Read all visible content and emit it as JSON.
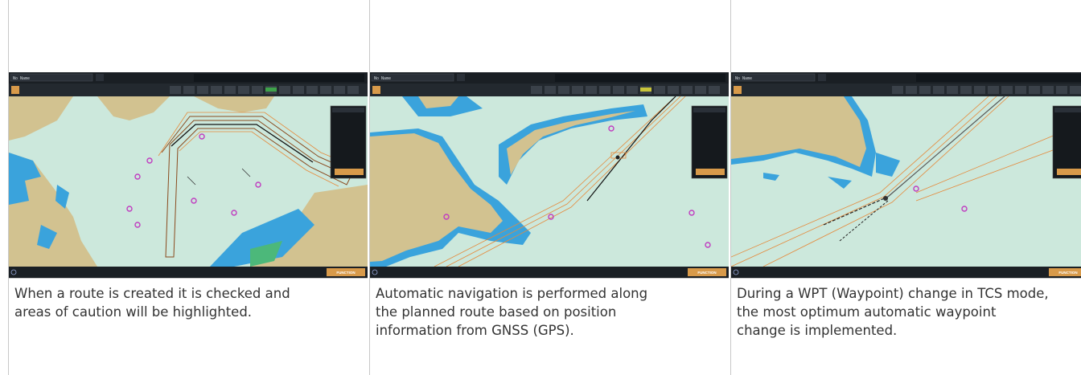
{
  "panels": [
    {
      "name": "route-check",
      "search_label": "No Name",
      "function_label": "FUNCTION",
      "caption_lines": [
        "When a route is created it is checked and",
        "areas of caution will be highlighted."
      ]
    },
    {
      "name": "automatic-navigation",
      "search_label": "No Name",
      "function_label": "FUNCTION",
      "caption_lines": [
        "Automatic navigation is performed along",
        "the planned route based on position",
        "information from GNSS (GPS)."
      ]
    },
    {
      "name": "wpt-change",
      "search_label": "No Name",
      "function_label": "FUNCTION",
      "caption_lines": [
        "During a WPT (Waypoint) change in TCS mode,",
        "the most optimum automatic waypoint",
        "change is implemented."
      ]
    }
  ],
  "colors": {
    "sea": "#cce8dc",
    "shallow": "#3aa3dc",
    "land": "#d2c290",
    "toolbar": "#1a1f24",
    "route_orange": "#e58a3c",
    "function_button": "#d89a4a",
    "magenta": "#c03cc0"
  }
}
